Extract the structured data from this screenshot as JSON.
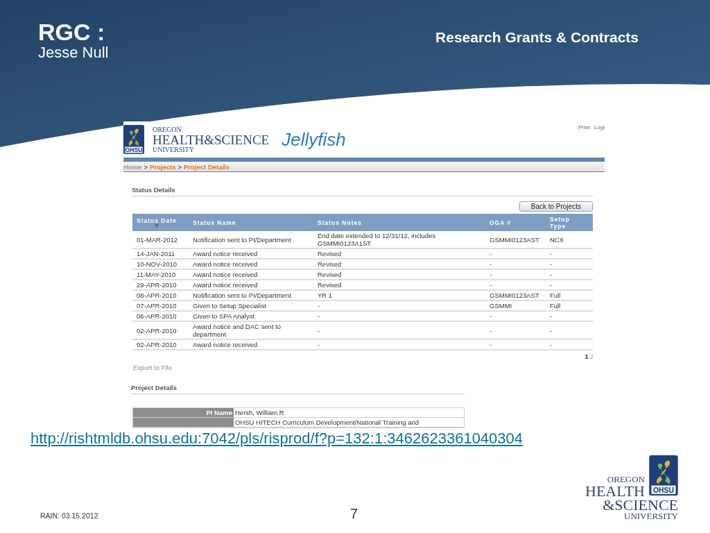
{
  "slide": {
    "title": "RGC :",
    "subtitle": "Jesse Null",
    "heading": "Research Grants & Contracts",
    "link": "http://rishtmldb.ohsu.edu:7042/pls/risprod/f?p=132:1:3462623361040304",
    "footer": "RAIN: 03.15.2012",
    "page_number": "7",
    "logo": {
      "lines": [
        "OREGON",
        "HEALTH",
        "&SCIENCE",
        "UNIVERSITY"
      ],
      "badge": "OHSU"
    }
  },
  "app": {
    "logo": {
      "lines": [
        "OREGON",
        "HEALTH&SCIENCE",
        "UNIVERSITY"
      ],
      "badge": "OHSU"
    },
    "app_name": "Jellyfish",
    "top_links": [
      "Print",
      "Logi"
    ],
    "breadcrumb": [
      {
        "kind": "home",
        "label": "Home"
      },
      {
        "kind": "separator",
        "label": ">"
      },
      {
        "kind": "link",
        "label": "Projects"
      },
      {
        "kind": "separator",
        "label": ">"
      },
      {
        "kind": "link",
        "label": "Project Details"
      }
    ],
    "status_section": {
      "title": "Status Details",
      "button": "Back to Projects",
      "columns": [
        {
          "label": "Status Date",
          "sorted": true
        },
        {
          "label": "Status Name",
          "sorted": false
        },
        {
          "label": "Status Notes",
          "sorted": false
        },
        {
          "label": "OGA #",
          "sorted": false
        },
        {
          "label": "Setup Type",
          "sorted": false
        }
      ],
      "rows": [
        [
          "01-MAR-2012",
          "Notification sent to PI/Department",
          "End date extended to 12/31/12, includes GSMMI0123A1ST",
          "GSMMI0123AST",
          "NCX"
        ],
        [
          "14-JAN-2011",
          "Award notice received",
          "Revised",
          "-",
          "-"
        ],
        [
          "10-NOV-2010",
          "Award notice received",
          "Revised",
          "-",
          "-"
        ],
        [
          "11-MAY-2010",
          "Award notice received",
          "Revised",
          "-",
          "-"
        ],
        [
          "29-APR-2010",
          "Award notice received",
          "Revised",
          "-",
          "-"
        ],
        [
          "08-APR-2010",
          "Notification sent to PI/Department",
          "YR 1",
          "GSMMI0123AST",
          "Full"
        ],
        [
          "07-APR-2010",
          "Given to Setup Specialist",
          "-",
          "GSMMI",
          "Full"
        ],
        [
          "06-APR-2010",
          "Given to SPA Analyst",
          "-",
          "-",
          "-"
        ],
        [
          "02-APR-2010",
          "Award notice and DAC sent to department",
          "-",
          "-",
          "-"
        ],
        [
          "02-APR-2010",
          "Award notice received",
          "-",
          "-",
          "-"
        ]
      ],
      "pages": [
        {
          "label": "1",
          "selected": true
        },
        {
          "label": "2",
          "selected": false
        }
      ],
      "export": "Export to File"
    },
    "project_section": {
      "title": "Project Details",
      "fields": [
        {
          "label": "PI Name",
          "value": "Hersh, William R"
        },
        {
          "value": "OHSU HITECH Curriculum Development/National Training and"
        }
      ]
    }
  }
}
